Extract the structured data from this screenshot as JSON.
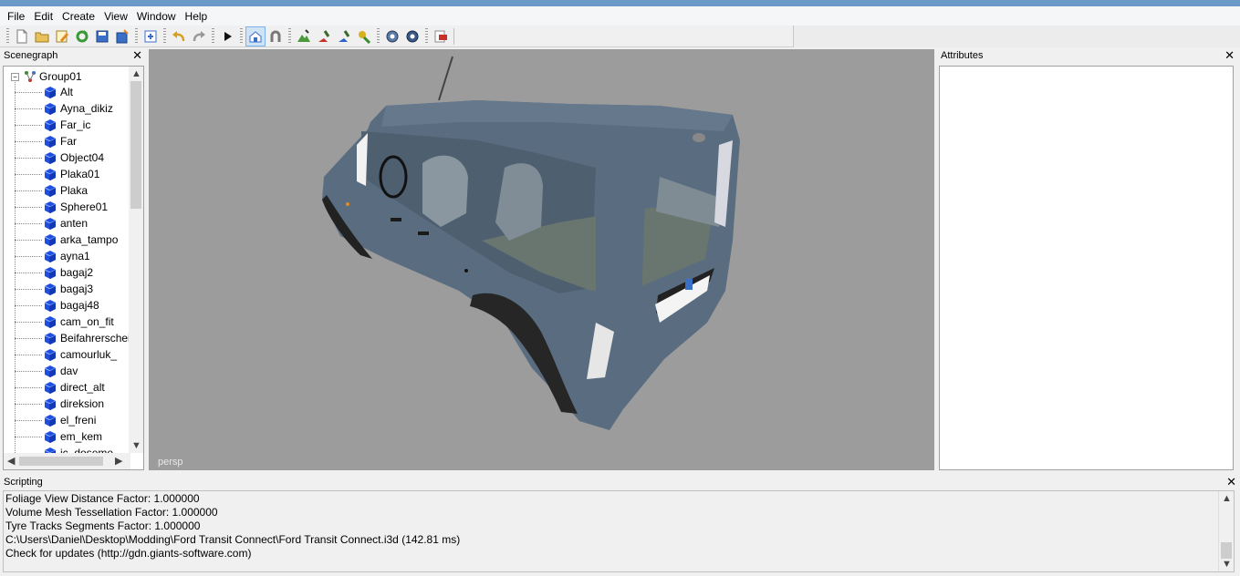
{
  "menu": [
    "File",
    "Edit",
    "Create",
    "View",
    "Window",
    "Help"
  ],
  "toolbar_icons": [
    "new-file-icon",
    "open-folder-icon",
    "edit-icon",
    "refresh-icon",
    "save-icon",
    "save-as-icon",
    "import-icon",
    "undo-icon",
    "redo-icon",
    "play-icon",
    "home-camera-icon",
    "magnet-icon",
    "terrain-tool-icon",
    "paint-tool-icon",
    "foliage-tool-icon",
    "placement-tool-icon",
    "settings-gear-icon",
    "settings-gear-alt-icon",
    "export-icon"
  ],
  "scenegraph": {
    "title": "Scenegraph",
    "root": "Group01",
    "items": [
      "Alt",
      "Ayna_dikiz",
      "Far_ic",
      "Far",
      "Object04",
      "Plaka01",
      "Plaka",
      "Sphere01",
      "anten",
      "arka_tampo",
      "ayna1",
      "bagaj2",
      "bagaj3",
      "bagaj48",
      "cam_on_fit",
      "Beifahrerschei",
      "camourluk_",
      "dav",
      "direct_alt",
      "direksion",
      "el_freni",
      "em_kem",
      "ic_doseme"
    ]
  },
  "viewport": {
    "camera_label": "persp"
  },
  "attributes": {
    "title": "Attributes"
  },
  "scripting": {
    "title": "Scripting",
    "lines": [
      "  Foliage View Distance Factor: 1.000000",
      "  Volume Mesh Tessellation Factor: 1.000000",
      "  Tyre Tracks Segments Factor: 1.000000",
      "C:\\Users\\Daniel\\Desktop\\Modding\\Ford Transit Connect\\Ford Transit Connect.i3d (142.81 ms)",
      "Check for updates (http://gdn.giants-software.com)"
    ]
  },
  "colors": {
    "titlebar": "#6b9ac9",
    "viewport_bg": "#9c9c9c",
    "van_body": "#5a6d80",
    "cube_blue": "#1f4fe0"
  }
}
